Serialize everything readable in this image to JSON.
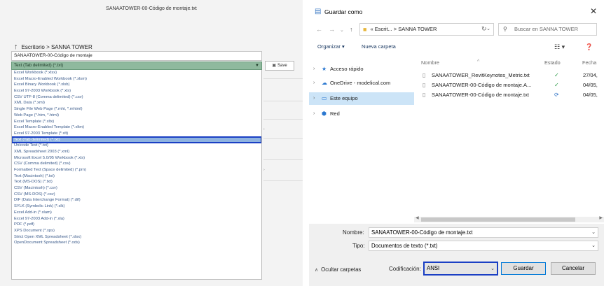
{
  "left": {
    "title": "SANAATOWER-00-Código de montaje.txt",
    "breadcrumb": "Escritorio > SANNA TOWER",
    "filename": "SANAATOWER-00-Código de montaje",
    "filetype": "Text (Tab delimited) (*.txt)",
    "save_label": "Save",
    "options": [
      "Excel Workbook (*.xlsx)",
      "Excel Macro-Enabled Workbook (*.xlsm)",
      "Excel Binary Workbook (*.xlsb)",
      "Excel 97-2003 Workbook (*.xls)",
      "CSV UTF-8 (Comma delimited) (*.csv)",
      "XML Data (*.xml)",
      "Single File Web Page (*.mht, *.mhtml)",
      "Web Page (*.htm, *.html)",
      "Excel Template (*.xltx)",
      "Excel Macro-Enabled Template (*.xltm)",
      "Excel 97-2003 Template (*.xlt)",
      "Text (Tab delimited) (*.txt)",
      "Unicode Text (*.txt)",
      "XML Spreadsheet 2003 (*.xml)",
      "Microsoft Excel 5.0/95 Workbook (*.xls)",
      "CSV (Comma delimited) (*.csv)",
      "Formatted Text (Space delimited) (*.prn)",
      "Text (Macintosh) (*.txt)",
      "Text (MS-DOS) (*.txt)",
      "CSV (Macintosh) (*.csv)",
      "CSV (MS-DOS) (*.csv)",
      "DIF (Data Interchange Format) (*.dif)",
      "SYLK (Symbolic Link) (*.slk)",
      "Excel Add-in (*.xlam)",
      "Excel 97-2003 Add-in (*.xla)",
      "PDF (*.pdf)",
      "XPS Document (*.xps)",
      "Strict Open XML Spreadsheet (*.xlsx)",
      "OpenDocument Spreadsheet (*.ods)"
    ],
    "selected_index": 11
  },
  "right": {
    "title": "Guardar como",
    "address": "« Escrit... > SANNA TOWER",
    "search_placeholder": "Buscar en SANNA TOWER",
    "toolbar": {
      "organize": "Organizar ▾",
      "new_folder": "Nueva carpeta"
    },
    "columns": {
      "name": "Nombre",
      "status": "Estado",
      "date": "Fecha"
    },
    "nav": [
      {
        "label": "Acceso rápido",
        "icon": "star-icon"
      },
      {
        "label": "OneDrive - modelical.com",
        "icon": "cloud-icon"
      },
      {
        "label": "Este equipo",
        "icon": "computer-icon"
      },
      {
        "label": "Red",
        "icon": "network-icon"
      }
    ],
    "files": [
      {
        "name": "SANAATOWER_RevitKeynotes_Metric.txt",
        "status": "synced",
        "date": "27/04,"
      },
      {
        "name": "SANAATOWER-00-Código de montaje.A...",
        "status": "synced",
        "date": "04/05,"
      },
      {
        "name": "SANAATOWER-00-Código de montaje.txt",
        "status": "syncing",
        "date": "04/05,"
      }
    ],
    "filename_label": "Nombre:",
    "filename_value": "SANAATOWER-00-Código de montaje.txt",
    "type_label": "Tipo:",
    "type_value": "Documentos de texto (*.txt)",
    "encoding_label": "Codificación:",
    "encoding_value": "ANSI",
    "save_button": "Guardar",
    "cancel_button": "Cancelar",
    "hide_folders": "Ocultar carpetas",
    "close_glyph": "✕"
  }
}
